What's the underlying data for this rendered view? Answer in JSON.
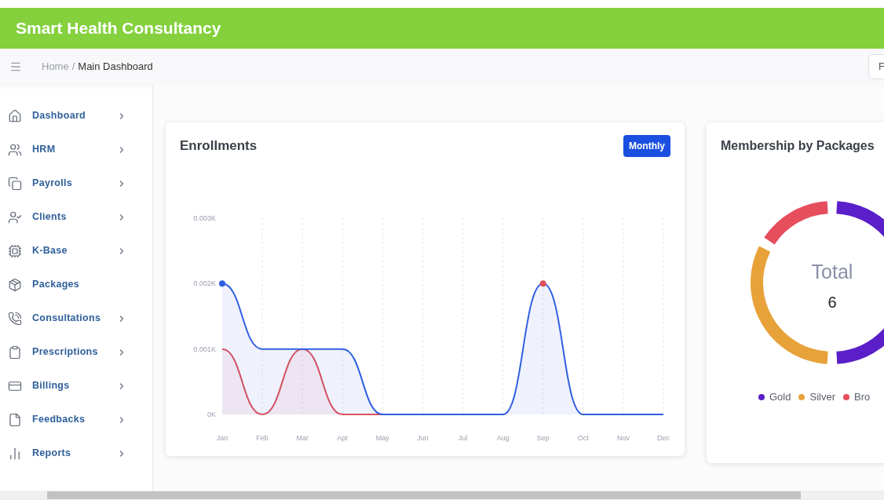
{
  "header": {
    "title": "Smart Health Consultancy"
  },
  "breadcrumb": {
    "home": "Home",
    "separator": "/",
    "current": "Main Dashboard",
    "action_button": "F"
  },
  "sidebar": {
    "items": [
      {
        "label": "Dashboard",
        "submenu": true
      },
      {
        "label": "HRM",
        "submenu": true
      },
      {
        "label": "Payrolls",
        "submenu": true
      },
      {
        "label": "Clients",
        "submenu": true
      },
      {
        "label": "K-Base",
        "submenu": true
      },
      {
        "label": "Packages",
        "submenu": false
      },
      {
        "label": "Consultations",
        "submenu": true
      },
      {
        "label": "Prescriptions",
        "submenu": true
      },
      {
        "label": "Billings",
        "submenu": true
      },
      {
        "label": "Feedbacks",
        "submenu": true
      },
      {
        "label": "Reports",
        "submenu": true
      }
    ]
  },
  "enrollments": {
    "title": "Enrollments",
    "period_button": "Monthly",
    "chart_data": {
      "type": "area",
      "grid": true,
      "categories": [
        "Jan",
        "Feb",
        "Mar",
        "Apr",
        "May",
        "Jun",
        "Jul",
        "Aug",
        "Sep",
        "Oct",
        "Nov",
        "Dec"
      ],
      "series": [
        {
          "color": "#2f5fe0",
          "values": [
            2,
            1,
            1,
            1,
            0,
            0,
            0,
            0,
            2,
            0,
            0,
            0
          ]
        },
        {
          "color": "#e0525a",
          "values": [
            1,
            0,
            1,
            0,
            0,
            null,
            null,
            null,
            null,
            null,
            null,
            null
          ]
        }
      ],
      "ylim": [
        0,
        3
      ],
      "yticks": [
        {
          "value": 0,
          "label": "0K"
        },
        {
          "value": 1,
          "label": "0.001K"
        },
        {
          "value": 2,
          "label": "0.002K"
        },
        {
          "value": 3,
          "label": "0.003K"
        }
      ]
    }
  },
  "membership": {
    "title": "Membership by Packages",
    "center_label": "Total",
    "center_value": "6",
    "chart_data": {
      "type": "donut",
      "categories": [
        "Gold",
        "Silver",
        "Bro"
      ],
      "values": [
        50,
        33.33,
        16.67
      ],
      "colors": [
        "#5a1fc9",
        "#e8a23a",
        "#e64e5e"
      ]
    }
  }
}
